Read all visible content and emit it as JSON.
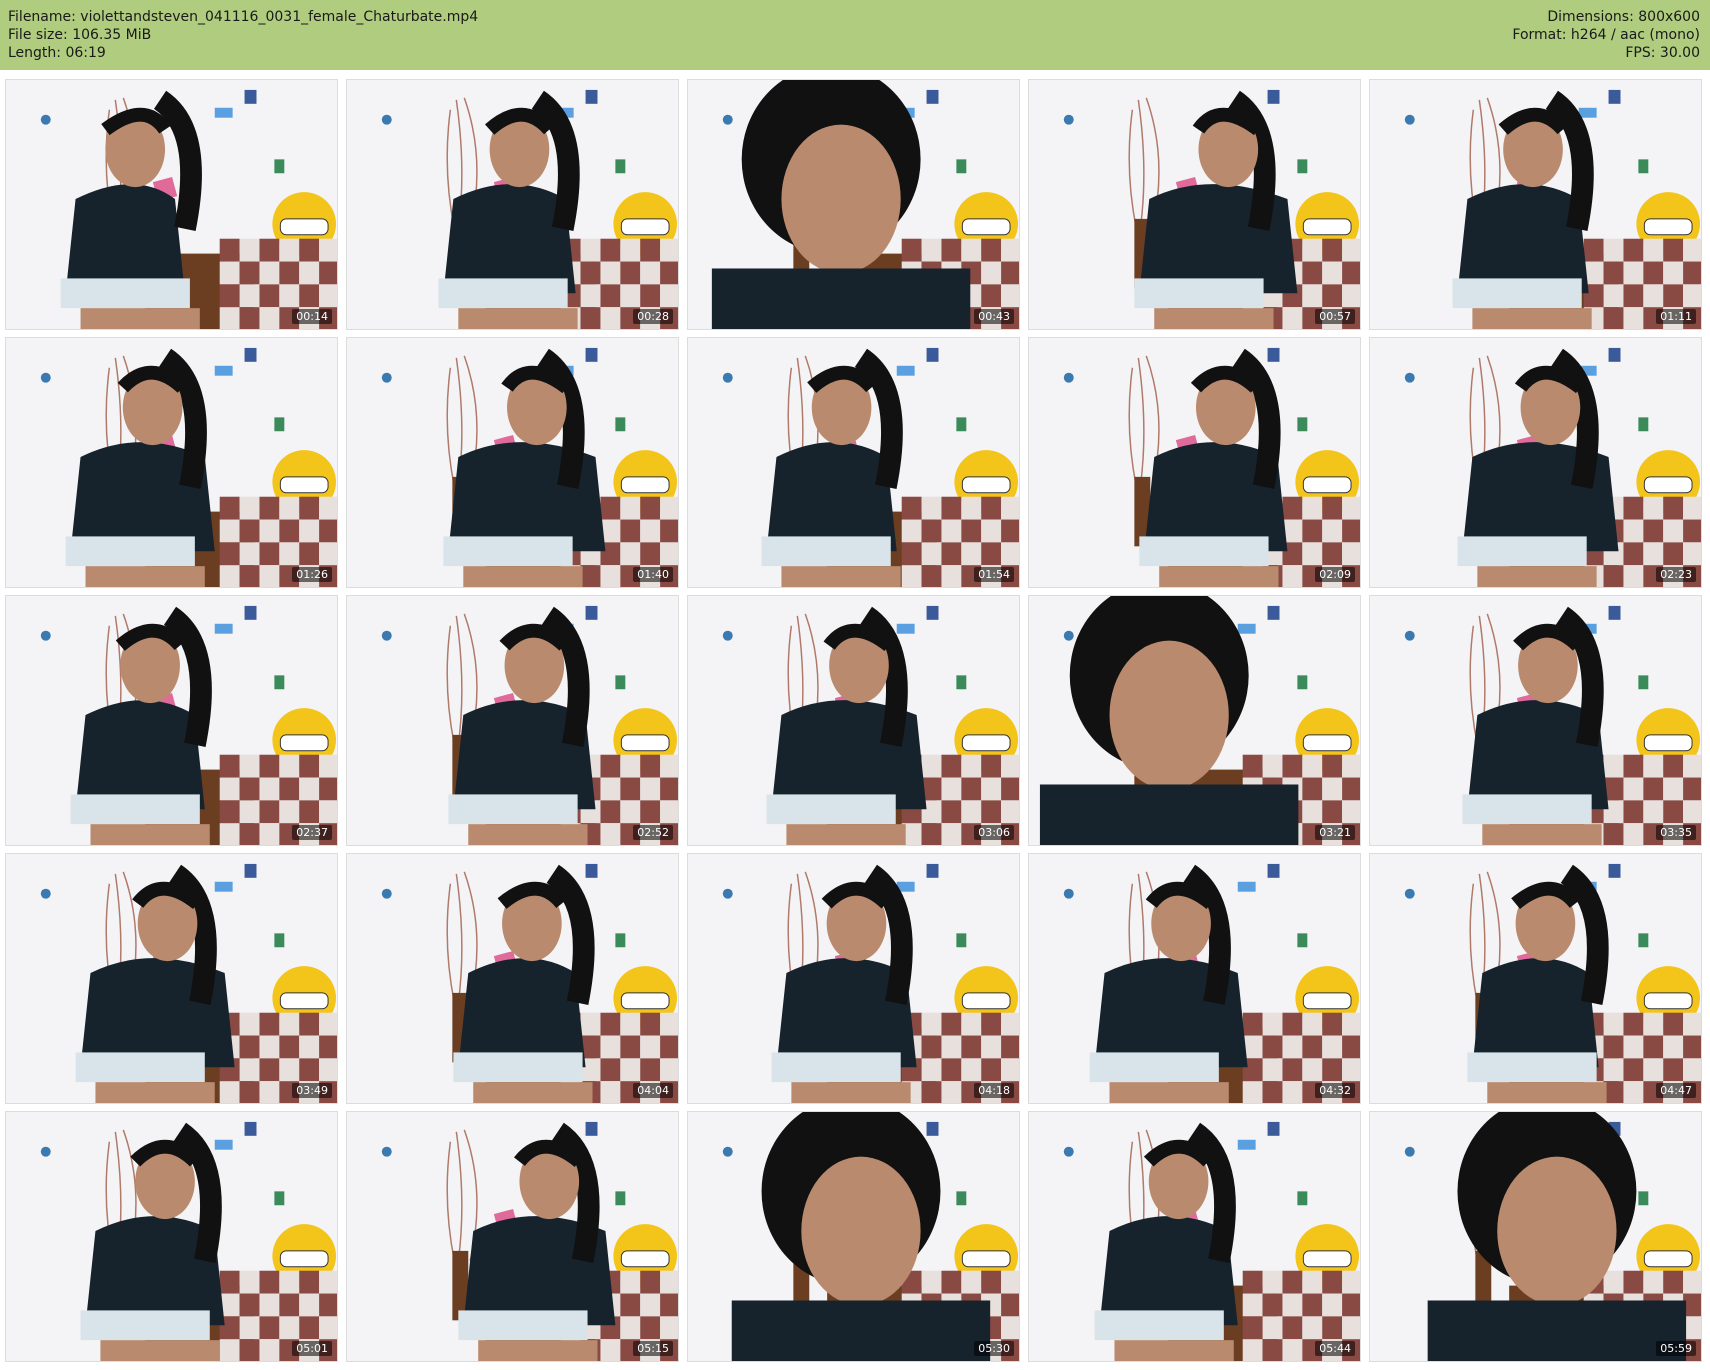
{
  "header": {
    "filename_line": "Filename: violettandsteven_041116_0031_female_Chaturbate.mp4",
    "filesize_line": "File size: 106.35 MiB",
    "length_line": "Length: 06:19",
    "dimensions_line": "Dimensions: 800x600",
    "format_line": "Format: h264 / aac (mono)",
    "fps_line": "FPS: 30.00"
  },
  "colors": {
    "header_bg": "#b0cc7e",
    "wall": "#f4f4f6",
    "shirt": "#16232d",
    "hair": "#111111",
    "skin": "#b98a6d",
    "blanket_red": "#8a4a44",
    "blanket_white": "#e8e0dc",
    "emoji_yellow": "#f3c419",
    "box_brown": "#6b3e22"
  },
  "thumbnails": [
    {
      "time": "00:14"
    },
    {
      "time": "00:28"
    },
    {
      "time": "00:43"
    },
    {
      "time": "00:57"
    },
    {
      "time": "01:11"
    },
    {
      "time": "01:26"
    },
    {
      "time": "01:40"
    },
    {
      "time": "01:54"
    },
    {
      "time": "02:09"
    },
    {
      "time": "02:23"
    },
    {
      "time": "02:37"
    },
    {
      "time": "02:52"
    },
    {
      "time": "03:06"
    },
    {
      "time": "03:21"
    },
    {
      "time": "03:35"
    },
    {
      "time": "03:49"
    },
    {
      "time": "04:04"
    },
    {
      "time": "04:18"
    },
    {
      "time": "04:32"
    },
    {
      "time": "04:47"
    },
    {
      "time": "05:01"
    },
    {
      "time": "05:15"
    },
    {
      "time": "05:30"
    },
    {
      "time": "05:44"
    },
    {
      "time": "05:59"
    }
  ]
}
